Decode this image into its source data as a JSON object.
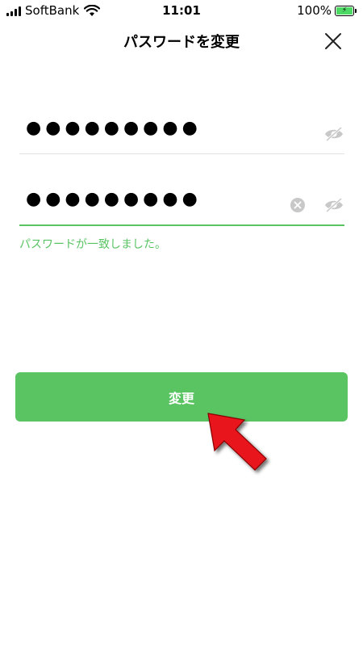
{
  "status_bar": {
    "carrier": "SoftBank",
    "time": "11:01",
    "battery": "100%"
  },
  "header": {
    "title": "パスワードを変更",
    "close_icon": "close-icon"
  },
  "fields": {
    "password": {
      "value": "●●●●●●●●●",
      "icon": "eye-slash-icon"
    },
    "confirm": {
      "value": "●●●●●●●●●",
      "icons": [
        "clear-icon",
        "eye-slash-icon"
      ]
    }
  },
  "messages": {
    "match": "パスワードが一致しました。"
  },
  "button": {
    "label": "変更"
  },
  "colors": {
    "accent": "#5ac463",
    "annotation_arrow": "#e8121d"
  }
}
